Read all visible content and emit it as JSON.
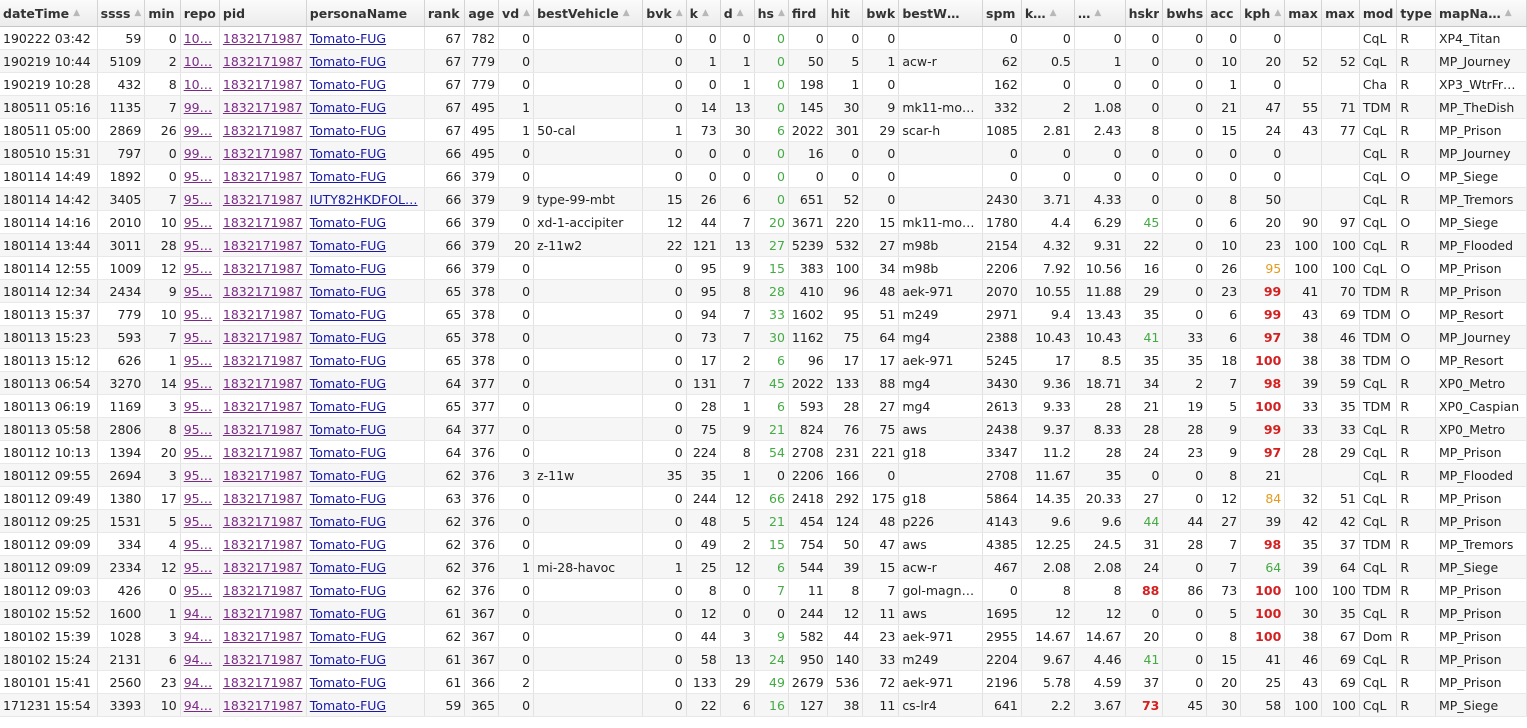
{
  "table": {
    "columns": [
      {
        "key": "dateTime",
        "label": "dateTime",
        "sort_icon": "up-down-arrow-icon"
      },
      {
        "key": "ssss",
        "label": "ssss",
        "sort_icon": "up-down-arrow-icon"
      },
      {
        "key": "min",
        "label": "min"
      },
      {
        "key": "repo",
        "label": "repo"
      },
      {
        "key": "pid",
        "label": "pid"
      },
      {
        "key": "personaName",
        "label": "personaName"
      },
      {
        "key": "rank",
        "label": "rank"
      },
      {
        "key": "age",
        "label": "age"
      },
      {
        "key": "vd",
        "label": "vd",
        "sort_icon": "up-down-arrow-icon"
      },
      {
        "key": "bestVehicle",
        "label": "bestVehicle",
        "sort_icon": "up-down-arrow-icon"
      },
      {
        "key": "bvk",
        "label": "bvk",
        "sort_icon": "up-down-arrow-icon"
      },
      {
        "key": "k",
        "label": "k",
        "sort_icon": "up-down-arrow-icon"
      },
      {
        "key": "d",
        "label": "d",
        "sort_icon": "up-down-arrow-icon"
      },
      {
        "key": "hs",
        "label": "hs",
        "sort_icon": "up-down-arrow-icon"
      },
      {
        "key": "fird",
        "label": "fird"
      },
      {
        "key": "hit",
        "label": "hit"
      },
      {
        "key": "bwk",
        "label": "bwk"
      },
      {
        "key": "bestW",
        "label": "bestW…"
      },
      {
        "key": "spm",
        "label": "spm"
      },
      {
        "key": "kd",
        "label": "k…",
        "sort_icon": "up-down-arrow-icon"
      },
      {
        "key": "kd2",
        "label": "…",
        "sort_icon": "up-down-arrow-icon"
      },
      {
        "key": "hskr",
        "label": "hskr"
      },
      {
        "key": "bwhs",
        "label": "bwhs"
      },
      {
        "key": "acc",
        "label": "acc"
      },
      {
        "key": "kph",
        "label": "kph",
        "sort_icon": "up-down-arrow-icon"
      },
      {
        "key": "max1",
        "label": "max"
      },
      {
        "key": "max2",
        "label": "max"
      },
      {
        "key": "mod",
        "label": "mod"
      },
      {
        "key": "type",
        "label": "type"
      },
      {
        "key": "mapName",
        "label": "mapNa…",
        "sort_icon": "up-down-arrow-icon"
      }
    ],
    "rows": [
      [
        "190222 03:42",
        "59",
        "0",
        "10…",
        "1832171987",
        "Tomato-FUG",
        "67",
        "782",
        "0",
        "",
        "0",
        "0",
        "0",
        "0",
        "0",
        "0",
        "0",
        "",
        "0",
        "0",
        "0",
        "0",
        "0",
        "0",
        "0",
        "",
        "",
        "CqL",
        "R",
        "XP4_Titan"
      ],
      [
        "190219 10:44",
        "5109",
        "2",
        "10…",
        "1832171987",
        "Tomato-FUG",
        "67",
        "779",
        "0",
        "",
        "0",
        "1",
        "1",
        "0",
        "50",
        "5",
        "1",
        "acw-r",
        "62",
        "0.5",
        "1",
        "0",
        "0",
        "10",
        "20",
        "52",
        "52",
        "CqL",
        "R",
        "MP_Journey"
      ],
      [
        "190219 10:28",
        "432",
        "8",
        "10…",
        "1832171987",
        "Tomato-FUG",
        "67",
        "779",
        "0",
        "",
        "0",
        "0",
        "1",
        "0",
        "198",
        "1",
        "0",
        "",
        "162",
        "0",
        "0",
        "0",
        "0",
        "1",
        "0",
        "",
        "",
        "Cha",
        "R",
        "XP3_WtrFr…"
      ],
      [
        "180511 05:16",
        "1135",
        "7",
        "99…",
        "1832171987",
        "Tomato-FUG",
        "67",
        "495",
        "1",
        "",
        "0",
        "14",
        "13",
        "0",
        "145",
        "30",
        "9",
        "mk11-mo…",
        "332",
        "2",
        "1.08",
        "0",
        "0",
        "21",
        "47",
        "55",
        "71",
        "TDM",
        "R",
        "MP_TheDish"
      ],
      [
        "180511 05:00",
        "2869",
        "26",
        "99…",
        "1832171987",
        "Tomato-FUG",
        "67",
        "495",
        "1",
        "50-cal",
        "1",
        "73",
        "30",
        "6",
        "2022",
        "301",
        "29",
        "scar-h",
        "1085",
        "2.81",
        "2.43",
        "8",
        "0",
        "15",
        "24",
        "43",
        "77",
        "CqL",
        "R",
        "MP_Prison"
      ],
      [
        "180510 15:31",
        "797",
        "0",
        "99…",
        "1832171987",
        "Tomato-FUG",
        "66",
        "495",
        "0",
        "",
        "0",
        "0",
        "0",
        "0",
        "16",
        "0",
        "0",
        "",
        "0",
        "0",
        "0",
        "0",
        "0",
        "0",
        "0",
        "",
        "",
        "CqL",
        "R",
        "MP_Journey"
      ],
      [
        "180114 14:49",
        "1892",
        "0",
        "95…",
        "1832171987",
        "Tomato-FUG",
        "66",
        "379",
        "0",
        "",
        "0",
        "0",
        "0",
        "0",
        "0",
        "0",
        "0",
        "",
        "0",
        "0",
        "0",
        "0",
        "0",
        "0",
        "0",
        "",
        "",
        "CqL",
        "O",
        "MP_Siege"
      ],
      [
        "180114 14:42",
        "3405",
        "7",
        "95…",
        "1832171987",
        "IUTY82HKDFOL…",
        "66",
        "379",
        "9",
        "type-99-mbt",
        "15",
        "26",
        "6",
        "0",
        "651",
        "52",
        "0",
        "",
        "2430",
        "3.71",
        "4.33",
        "0",
        "0",
        "8",
        "50",
        "",
        "",
        "CqL",
        "R",
        "MP_Tremors"
      ],
      [
        "180114 14:16",
        "2010",
        "10",
        "95…",
        "1832171987",
        "Tomato-FUG",
        "66",
        "379",
        "0",
        "xd-1-accipiter",
        "12",
        "44",
        "7",
        "20",
        "3671",
        "220",
        "15",
        "mk11-mo…",
        "1780",
        "4.4",
        "6.29",
        "45",
        "0",
        "6",
        "20",
        "90",
        "97",
        "CqL",
        "O",
        "MP_Siege"
      ],
      [
        "180114 13:44",
        "3011",
        "28",
        "95…",
        "1832171987",
        "Tomato-FUG",
        "66",
        "379",
        "20",
        "z-11w2",
        "22",
        "121",
        "13",
        "27",
        "5239",
        "532",
        "27",
        "m98b",
        "2154",
        "4.32",
        "9.31",
        "22",
        "0",
        "10",
        "23",
        "100",
        "100",
        "CqL",
        "R",
        "MP_Flooded"
      ],
      [
        "180114 12:55",
        "1009",
        "12",
        "95…",
        "1832171987",
        "Tomato-FUG",
        "66",
        "379",
        "0",
        "",
        "0",
        "95",
        "9",
        "15",
        "383",
        "100",
        "34",
        "m98b",
        "2206",
        "7.92",
        "10.56",
        "16",
        "0",
        "26",
        "95",
        "100",
        "100",
        "CqL",
        "O",
        "MP_Prison"
      ],
      [
        "180114 12:34",
        "2434",
        "9",
        "95…",
        "1832171987",
        "Tomato-FUG",
        "65",
        "378",
        "0",
        "",
        "0",
        "95",
        "8",
        "28",
        "410",
        "96",
        "48",
        "aek-971",
        "2070",
        "10.55",
        "11.88",
        "29",
        "0",
        "23",
        "99",
        "41",
        "70",
        "TDM",
        "R",
        "MP_Prison"
      ],
      [
        "180113 15:37",
        "779",
        "10",
        "95…",
        "1832171987",
        "Tomato-FUG",
        "65",
        "378",
        "0",
        "",
        "0",
        "94",
        "7",
        "33",
        "1602",
        "95",
        "51",
        "m249",
        "2971",
        "9.4",
        "13.43",
        "35",
        "0",
        "6",
        "99",
        "43",
        "69",
        "TDM",
        "O",
        "MP_Resort"
      ],
      [
        "180113 15:23",
        "593",
        "7",
        "95…",
        "1832171987",
        "Tomato-FUG",
        "65",
        "378",
        "0",
        "",
        "0",
        "73",
        "7",
        "30",
        "1162",
        "75",
        "64",
        "mg4",
        "2388",
        "10.43",
        "10.43",
        "41",
        "33",
        "6",
        "97",
        "38",
        "46",
        "TDM",
        "O",
        "MP_Journey"
      ],
      [
        "180113 15:12",
        "626",
        "1",
        "95…",
        "1832171987",
        "Tomato-FUG",
        "65",
        "378",
        "0",
        "",
        "0",
        "17",
        "2",
        "6",
        "96",
        "17",
        "17",
        "aek-971",
        "5245",
        "17",
        "8.5",
        "35",
        "35",
        "18",
        "100",
        "38",
        "38",
        "TDM",
        "O",
        "MP_Resort"
      ],
      [
        "180113 06:54",
        "3270",
        "14",
        "95…",
        "1832171987",
        "Tomato-FUG",
        "64",
        "377",
        "0",
        "",
        "0",
        "131",
        "7",
        "45",
        "2022",
        "133",
        "88",
        "mg4",
        "3430",
        "9.36",
        "18.71",
        "34",
        "2",
        "7",
        "98",
        "39",
        "59",
        "CqL",
        "R",
        "XP0_Metro"
      ],
      [
        "180113 06:19",
        "1169",
        "3",
        "95…",
        "1832171987",
        "Tomato-FUG",
        "65",
        "377",
        "0",
        "",
        "0",
        "28",
        "1",
        "6",
        "593",
        "28",
        "27",
        "mg4",
        "2613",
        "9.33",
        "28",
        "21",
        "19",
        "5",
        "100",
        "33",
        "35",
        "TDM",
        "R",
        "XP0_Caspian"
      ],
      [
        "180113 05:58",
        "2806",
        "8",
        "95…",
        "1832171987",
        "Tomato-FUG",
        "64",
        "377",
        "0",
        "",
        "0",
        "75",
        "9",
        "21",
        "824",
        "76",
        "75",
        "aws",
        "2438",
        "9.37",
        "8.33",
        "28",
        "28",
        "9",
        "99",
        "33",
        "33",
        "CqL",
        "R",
        "XP0_Metro"
      ],
      [
        "180112 10:13",
        "1394",
        "20",
        "95…",
        "1832171987",
        "Tomato-FUG",
        "64",
        "376",
        "0",
        "",
        "0",
        "224",
        "8",
        "54",
        "2708",
        "231",
        "221",
        "g18",
        "3347",
        "11.2",
        "28",
        "24",
        "23",
        "9",
        "97",
        "28",
        "29",
        "CqL",
        "R",
        "MP_Prison"
      ],
      [
        "180112 09:55",
        "2694",
        "3",
        "95…",
        "1832171987",
        "Tomato-FUG",
        "62",
        "376",
        "3",
        "z-11w",
        "35",
        "35",
        "1",
        "0",
        "2206",
        "166",
        "0",
        "",
        "2708",
        "11.67",
        "35",
        "0",
        "0",
        "8",
        "21",
        "",
        "",
        "CqL",
        "R",
        "MP_Flooded"
      ],
      [
        "180112 09:49",
        "1380",
        "17",
        "95…",
        "1832171987",
        "Tomato-FUG",
        "63",
        "376",
        "0",
        "",
        "0",
        "244",
        "12",
        "66",
        "2418",
        "292",
        "175",
        "g18",
        "5864",
        "14.35",
        "20.33",
        "27",
        "0",
        "12",
        "84",
        "32",
        "51",
        "CqL",
        "R",
        "MP_Prison"
      ],
      [
        "180112 09:25",
        "1531",
        "5",
        "95…",
        "1832171987",
        "Tomato-FUG",
        "62",
        "376",
        "0",
        "",
        "0",
        "48",
        "5",
        "21",
        "454",
        "124",
        "48",
        "p226",
        "4143",
        "9.6",
        "9.6",
        "44",
        "44",
        "27",
        "39",
        "42",
        "42",
        "CqL",
        "R",
        "MP_Prison"
      ],
      [
        "180112 09:09",
        "334",
        "4",
        "95…",
        "1832171987",
        "Tomato-FUG",
        "62",
        "376",
        "0",
        "",
        "0",
        "49",
        "2",
        "15",
        "754",
        "50",
        "47",
        "aws",
        "4385",
        "12.25",
        "24.5",
        "31",
        "28",
        "7",
        "98",
        "35",
        "37",
        "TDM",
        "R",
        "MP_Tremors"
      ],
      [
        "180112 09:09",
        "2334",
        "12",
        "95…",
        "1832171987",
        "Tomato-FUG",
        "62",
        "376",
        "1",
        "mi-28-havoc",
        "1",
        "25",
        "12",
        "6",
        "544",
        "39",
        "15",
        "acw-r",
        "467",
        "2.08",
        "2.08",
        "24",
        "0",
        "7",
        "64",
        "39",
        "64",
        "CqL",
        "R",
        "MP_Siege"
      ],
      [
        "180112 09:03",
        "426",
        "0",
        "95…",
        "1832171987",
        "Tomato-FUG",
        "62",
        "376",
        "0",
        "",
        "0",
        "8",
        "0",
        "7",
        "11",
        "8",
        "7",
        "gol-magn…",
        "0",
        "8",
        "8",
        "88",
        "86",
        "73",
        "100",
        "100",
        "100",
        "TDM",
        "R",
        "MP_Prison"
      ],
      [
        "180102 15:52",
        "1600",
        "1",
        "94…",
        "1832171987",
        "Tomato-FUG",
        "61",
        "367",
        "0",
        "",
        "0",
        "12",
        "0",
        "0",
        "244",
        "12",
        "11",
        "aws",
        "1695",
        "12",
        "12",
        "0",
        "0",
        "5",
        "100",
        "30",
        "35",
        "CqL",
        "R",
        "MP_Prison"
      ],
      [
        "180102 15:39",
        "1028",
        "3",
        "94…",
        "1832171987",
        "Tomato-FUG",
        "62",
        "367",
        "0",
        "",
        "0",
        "44",
        "3",
        "9",
        "582",
        "44",
        "23",
        "aek-971",
        "2955",
        "14.67",
        "14.67",
        "20",
        "0",
        "8",
        "100",
        "38",
        "67",
        "Dom",
        "R",
        "MP_Prison"
      ],
      [
        "180102 15:24",
        "2131",
        "6",
        "94…",
        "1832171987",
        "Tomato-FUG",
        "61",
        "367",
        "0",
        "",
        "0",
        "58",
        "13",
        "24",
        "950",
        "140",
        "33",
        "m249",
        "2204",
        "9.67",
        "4.46",
        "41",
        "0",
        "15",
        "41",
        "46",
        "69",
        "CqL",
        "R",
        "MP_Prison"
      ],
      [
        "180101 15:41",
        "2560",
        "23",
        "94…",
        "1832171987",
        "Tomato-FUG",
        "61",
        "366",
        "2",
        "",
        "0",
        "133",
        "29",
        "49",
        "2679",
        "536",
        "72",
        "aek-971",
        "2196",
        "5.78",
        "4.59",
        "37",
        "0",
        "20",
        "25",
        "43",
        "69",
        "CqL",
        "R",
        "MP_Prison"
      ],
      [
        "171231 15:54",
        "3393",
        "10",
        "94…",
        "1832171987",
        "Tomato-FUG",
        "59",
        "365",
        "0",
        "",
        "0",
        "22",
        "6",
        "16",
        "127",
        "38",
        "11",
        "cs-lr4",
        "641",
        "2.2",
        "3.67",
        "73",
        "45",
        "30",
        "58",
        "100",
        "100",
        "CqL",
        "R",
        "MP_Siege"
      ]
    ]
  },
  "colors": {
    "link": "#1a1aa6",
    "visited_link": "#7a2a86",
    "green": "#44aa44",
    "orange": "#e59a1c",
    "red": "#d42020"
  }
}
